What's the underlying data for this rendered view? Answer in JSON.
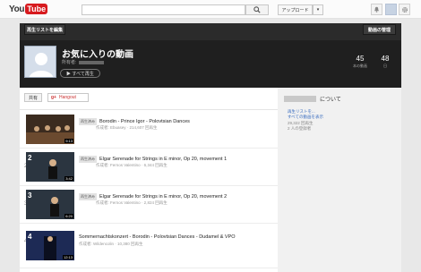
{
  "logo": {
    "you": "You",
    "tube": "Tube"
  },
  "header": {
    "upload_label": "アップロード",
    "upload_arrow": "▾"
  },
  "topbar_buttons": {
    "back_label": "再生リストを編集",
    "edit_label": "動画の管理"
  },
  "playlist": {
    "title": "お気に入りの動画",
    "owner_label": "所有者:",
    "play_all": "▶ すべて再生",
    "stats": [
      {
        "value": "45",
        "label": "本の動画"
      },
      {
        "value": "48",
        "label": "日"
      }
    ]
  },
  "actions": {
    "share": "共有",
    "hangout_icon": "g+",
    "hangout": "Hangout"
  },
  "videos": [
    {
      "num": "",
      "thumb_num": "",
      "duration": "9:13",
      "badge": "再生済み",
      "title": "Borodin - Prince Igor - Polovtsian Dances",
      "meta": "作成者: Ebuasey · 214,607 回再生",
      "color": "#4a3a2a"
    },
    {
      "num": "2",
      "thumb_num": "2",
      "duration": "3:42",
      "badge": "再生済み",
      "title": "Elgar Serenade for Strings in E minor, Op 20, movement 1",
      "meta": "作成者: Fernos Valentino · 6,344 回再生",
      "color": "#2f3d4a"
    },
    {
      "num": "3",
      "thumb_num": "3",
      "duration": "6:20",
      "badge": "再生済み",
      "title": "Elgar Serenade for Strings in E minor, Op 20, movement 2",
      "meta": "作成者: Fernos Valentino · 2,824 回再生",
      "color": "#2f3d4a"
    },
    {
      "num": "4",
      "thumb_num": "4",
      "duration": "12:13",
      "badge": "",
      "title": "Sommernachtskonzert - Borodin - Polovtsian Dances - Dudamel & VPO",
      "meta": "作成者: Wildencolin · 10,380 回再生",
      "color": "#1e2a4a"
    }
  ],
  "sidebar": {
    "about": "について",
    "link1": "再生リストを...",
    "link2": "すべての動画を表示",
    "line3": "29,322 回再生",
    "line4": "2 人の登録者"
  },
  "icons": {
    "search": "search-icon",
    "bell": "bell-icon",
    "gear": "gear-icon",
    "upload_dropdown": "chevron-down-icon"
  }
}
